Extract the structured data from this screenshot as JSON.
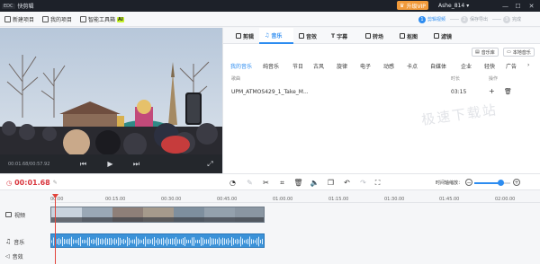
{
  "app": {
    "logo_mark": "EDC",
    "name": "快剪辑"
  },
  "titlebar": {
    "vip_label": "升级VIP",
    "username": "Ashe_814"
  },
  "toolbar": {
    "new_project": "新建项目",
    "my_projects": "我的项目",
    "smart_toolbox": "智能工具箱",
    "ai_badge": "AI"
  },
  "steps": [
    {
      "num": "1",
      "label": "剪辑视频"
    },
    {
      "num": "2",
      "label": "保存导出"
    },
    {
      "num": "3",
      "label": "完成"
    }
  ],
  "preview": {
    "timecode": "00:01.68/00:57.92"
  },
  "tabs": [
    "剪辑",
    "音乐",
    "音效",
    "字幕",
    "转场",
    "抠图",
    "滤镜"
  ],
  "active_tab": "音乐",
  "library_buttons": {
    "music_library": "音乐库",
    "local_music": "本地音乐"
  },
  "categories": [
    "我的音乐",
    "纯音乐",
    "节日",
    "古风",
    "旋律",
    "电子",
    "动感",
    "卡点",
    "自媒体",
    "企业",
    "轻快",
    "广告"
  ],
  "list_headers": {
    "title": "歌曲",
    "duration": "时长",
    "action": "操作"
  },
  "songs": [
    {
      "title": "UPM_ATMOS429_1_Take_M...",
      "duration": "03:15"
    }
  ],
  "watermark": "极速下载站",
  "editbar": {
    "current_time": "00:01.68",
    "zoom_label": "时间轴缩放："
  },
  "ruler_ticks": [
    "00:00",
    "00:15.00",
    "00:30.00",
    "00:45.00",
    "01:00.00",
    "01:15.00",
    "01:30.00",
    "01:45.00",
    "02:00.00"
  ],
  "tracks": {
    "video": "视频",
    "music": "音乐",
    "sfx": "音效"
  },
  "colors": {
    "accent": "#2d8cf0",
    "playhead": "#e2453c",
    "vip": "#f19a3a"
  }
}
